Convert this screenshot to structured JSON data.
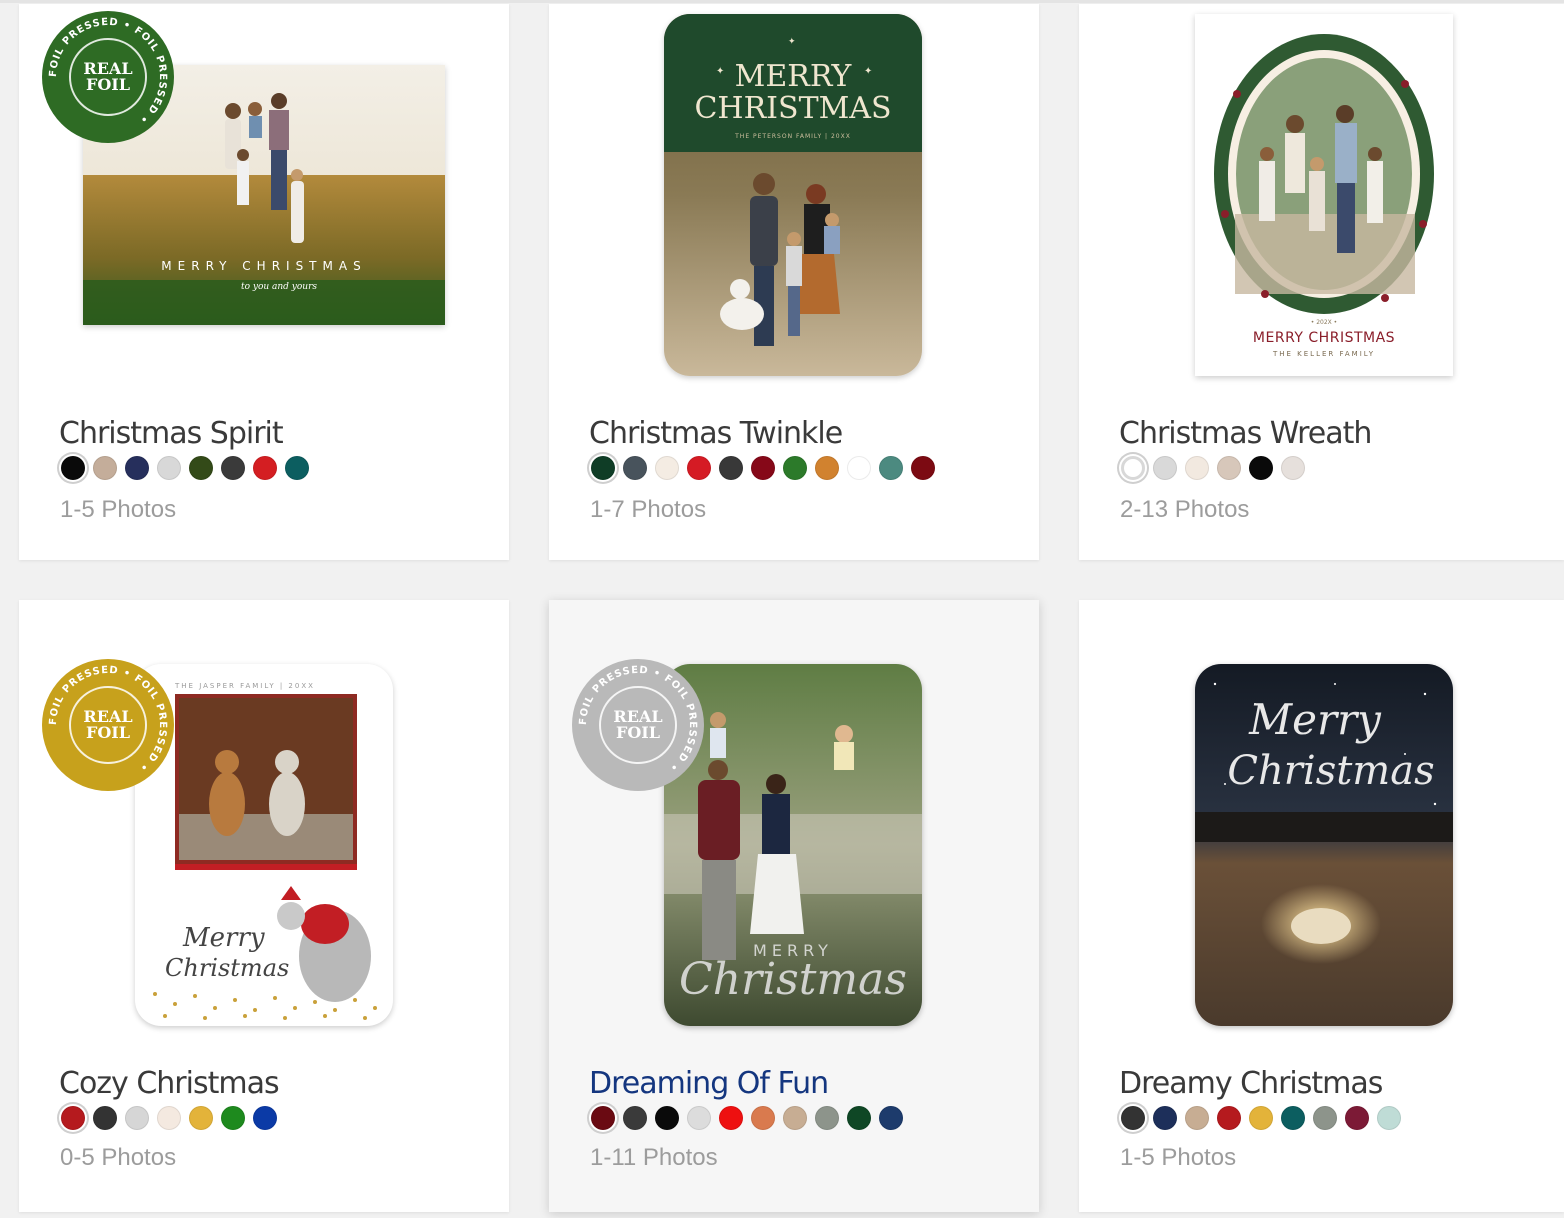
{
  "badge": {
    "line1": "REAL",
    "line2": "FOIL",
    "ring_text": "FOIL PRESSED • FOIL PRESSED •"
  },
  "products": [
    {
      "name": "Christmas Spirit",
      "photos": "1-5 Photos",
      "swatches": [
        "#0a0a0a",
        "#c4ad9a",
        "#262f5c",
        "#d8d8d8",
        "#334a18",
        "#3a3a3a",
        "#d41e22",
        "#0c5e60"
      ],
      "selected": 0,
      "badge_color": "#2e6b24",
      "card_text": {
        "main": "MERRY CHRISTMAS",
        "sub": "to you and yours"
      }
    },
    {
      "name": "Christmas Twinkle",
      "photos": "1-7 Photos",
      "swatches": [
        "#0f3d26",
        "#48535c",
        "#f4ece3",
        "#d51b24",
        "#383838",
        "#860818",
        "#2c7a2a",
        "#d1822f",
        "#ffffff",
        "#4c8a80",
        "#7c0a12"
      ],
      "selected": 0,
      "card_text": {
        "main1": "MERRY",
        "main2": "CHRISTMAS",
        "sub": "THE PETERSON FAMILY | 20XX"
      }
    },
    {
      "name": "Christmas Wreath",
      "photos": "2-13 Photos",
      "swatches": [
        "#ffffff",
        "#d9d9d9",
        "#f2e9e0",
        "#d7c7ba",
        "#0a0a0a",
        "#e6e0dc"
      ],
      "selected": 0,
      "card_text": {
        "year": "• 202X •",
        "main": "MERRY CHRISTMAS",
        "sub": "THE KELLER FAMILY"
      }
    },
    {
      "name": "Cozy Christmas",
      "photos": "0-5 Photos",
      "swatches": [
        "#b51a1e",
        "#333333",
        "#d6d6d6",
        "#f4e9e0",
        "#e3b33a",
        "#1e8a1e",
        "#0b3aa6"
      ],
      "selected": 0,
      "badge_color": "#c7a11c",
      "card_text": {
        "top": "THE JASPER FAMILY | 20XX",
        "main1": "Merry",
        "main2": "Christmas"
      }
    },
    {
      "name": "Dreaming Of Fun",
      "photos": "1-11 Photos",
      "swatches": [
        "#6a0a12",
        "#3a3a3a",
        "#0a0a0a",
        "#dcdcdc",
        "#ee1010",
        "#d97a4e",
        "#c7ad93",
        "#8d948b",
        "#0f4725",
        "#1d3b6c"
      ],
      "selected": 0,
      "badge_color": "#b9b9b9",
      "card_text": {
        "main1": "MERRY",
        "main2": "Christmas"
      }
    },
    {
      "name": "Dreamy Christmas",
      "photos": "1-5 Photos",
      "swatches": [
        "#333333",
        "#1d2f5a",
        "#c7ad93",
        "#b51a1e",
        "#e3b33a",
        "#0c5e60",
        "#8d948b",
        "#7c1a36",
        "#bfdcd6"
      ],
      "selected": 0,
      "card_text": {
        "main1": "Merry",
        "main2": "Christmas"
      }
    }
  ]
}
